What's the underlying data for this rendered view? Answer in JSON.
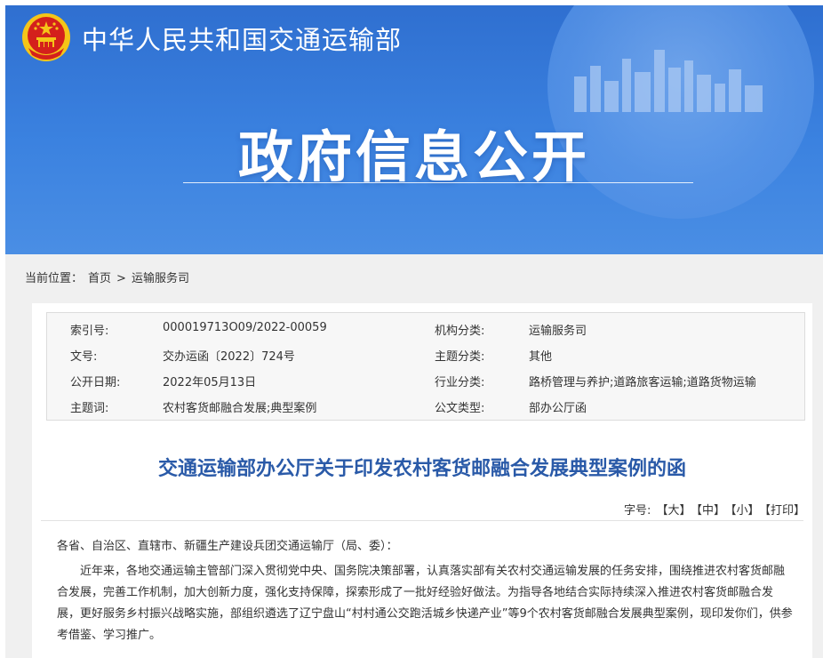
{
  "header": {
    "site_name": "中华人民共和国交通运输部",
    "hero_title": "政府信息公开"
  },
  "breadcrumb": {
    "prefix": "当前位置：",
    "home": "首页",
    "separator": ">",
    "section": "运输服务司"
  },
  "meta": [
    {
      "left_label": "索引号:",
      "left_value": "000019713O09/2022-00059",
      "right_label": "机构分类:",
      "right_value": "运输服务司"
    },
    {
      "left_label": "文号:",
      "left_value": "交办运函〔2022〕724号",
      "right_label": "主题分类:",
      "right_value": "其他"
    },
    {
      "left_label": "公开日期:",
      "left_value": "2022年05月13日",
      "right_label": "行业分类:",
      "right_value": "路桥管理与养护;道路旅客运输;道路货物运输"
    },
    {
      "left_label": "主题词:",
      "left_value": "农村客货邮融合发展;典型案例",
      "right_label": "公文类型:",
      "right_value": "部办公厅函"
    }
  ],
  "document": {
    "title": "交通运输部办公厅关于印发农村客货邮融合发展典型案例的函",
    "font_size_label": "字号:",
    "font_large": "【大】",
    "font_medium": "【中】",
    "font_small": "【小】",
    "print": "【打印】",
    "salutation": "各省、自治区、直辖市、新疆生产建设兵团交通运输厅（局、委）：",
    "paragraph_1": "近年来，各地交通运输主管部门深入贯彻党中央、国务院决策部署，认真落实部有关农村交通运输发展的任务安排，围绕推进农村客货邮融合发展，完善工作机制，加大创新力度，强化支持保障，探索形成了一批好经验好做法。为指导各地结合实际持续深入推进农村客货邮融合发展，更好服务乡村振兴战略实施，部组织遴选了辽宁盘山“村村通公交跑活城乡快递产业”等9个农村客货邮融合发展典型案例，现印发你们，供参考借鉴、学习推广。"
  },
  "colors": {
    "banner": "#3b82e0",
    "title_blue": "#2a5aa8",
    "emblem_red": "#d4201c",
    "emblem_gold": "#f5c518"
  }
}
